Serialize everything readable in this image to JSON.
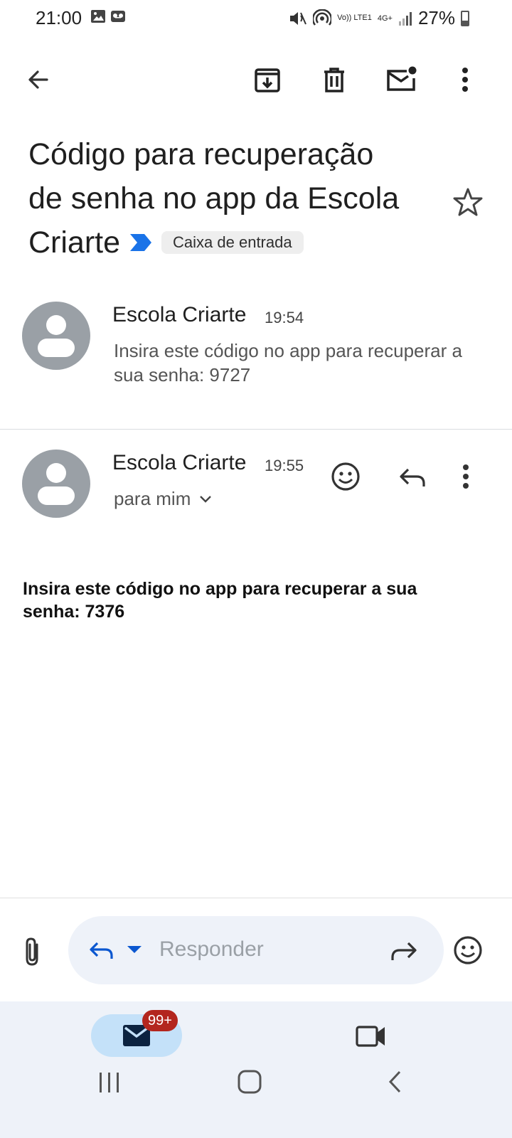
{
  "status_bar": {
    "time": "21:00",
    "battery": "27%",
    "network_volte": "Vo)) LTE1",
    "network_type": "4G+"
  },
  "toolbar": {
    "back_icon": "arrow-left-icon",
    "archive_icon": "archive-icon",
    "delete_icon": "trash-icon",
    "mark_unread_icon": "mail-unread-icon",
    "more_icon": "more-vertical-icon"
  },
  "email": {
    "subject_line1": "Código para recuperação",
    "subject_line2": "de senha no app da Escola",
    "subject_line3": "Criarte",
    "label": "Caixa de entrada",
    "importance_color": "#1a73e8"
  },
  "messages": [
    {
      "sender": "Escola Criarte",
      "time": "19:54",
      "snippet": "Insira este código no app para recuperar a sua senha: 9727"
    },
    {
      "sender": "Escola Criarte",
      "time": "19:55",
      "recipient": "para mim",
      "body": "Insira este código no app para recuperar a sua senha: 7376"
    }
  ],
  "reply_bar": {
    "placeholder": "Responder",
    "accent": "#0b57d0"
  },
  "bottom_nav": {
    "badge": "99+",
    "badge_color": "#b3261e",
    "pill_color": "#c4e1f9"
  }
}
